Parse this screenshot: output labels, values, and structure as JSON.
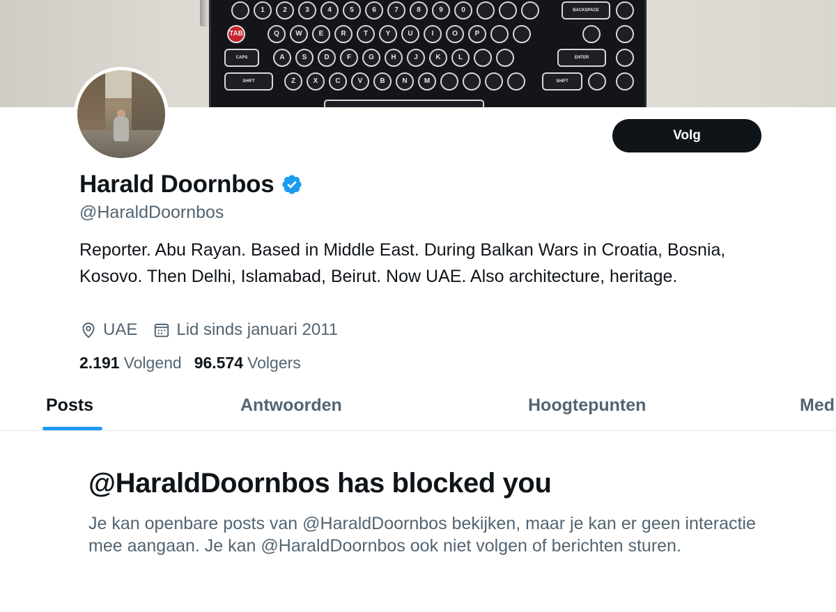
{
  "profile": {
    "name": "Harald Doornbos",
    "handle": "@HaraldDoornbos",
    "bio": "Reporter. Abu Rayan. Based in Middle East. During Balkan Wars in Croatia, Bosnia, Kosovo. Then Delhi, Islamabad, Beirut. Now UAE. Also architecture, heritage.",
    "location": "UAE",
    "joined": "Lid sinds januari 2011",
    "following_count": "2.191",
    "following_label": "Volgend",
    "followers_count": "96.574",
    "followers_label": "Volgers",
    "verified": true,
    "verified_color": "#1d9bf0"
  },
  "actions": {
    "follow_label": "Volg"
  },
  "tabs": [
    {
      "label": "Posts",
      "active": true
    },
    {
      "label": "Antwoorden",
      "active": false
    },
    {
      "label": "Hoogtepunten",
      "active": false
    },
    {
      "label": "Med",
      "active": false
    }
  ],
  "blocked": {
    "title": "@HaraldDoornbos has blocked you",
    "message": "Je kan openbare posts van @HaraldDoornbos bekijken, maar je kan er geen interactie mee aangaan. Je kan @HaraldDoornbos ook niet volgen of berichten sturen."
  },
  "banner": {
    "row1": [
      "1",
      "2",
      "3",
      "4",
      "5",
      "6",
      "7",
      "8",
      "9",
      "0"
    ],
    "row2": [
      "Q",
      "W",
      "E",
      "R",
      "T",
      "Y",
      "U",
      "I",
      "O",
      "P"
    ],
    "row3": [
      "A",
      "S",
      "D",
      "F",
      "G",
      "H",
      "J",
      "K",
      "L"
    ],
    "row4": [
      "Z",
      "X",
      "C",
      "V",
      "B",
      "N",
      "M"
    ],
    "wide": [
      "BACKSPACE",
      "TAB",
      "CAPS",
      "ENTER",
      "SHIFT",
      "SHIFT"
    ]
  },
  "colors": {
    "accent": "#1d9bf0",
    "text_primary": "#0f1419",
    "text_secondary": "#536471",
    "button_bg": "#0f1419"
  }
}
